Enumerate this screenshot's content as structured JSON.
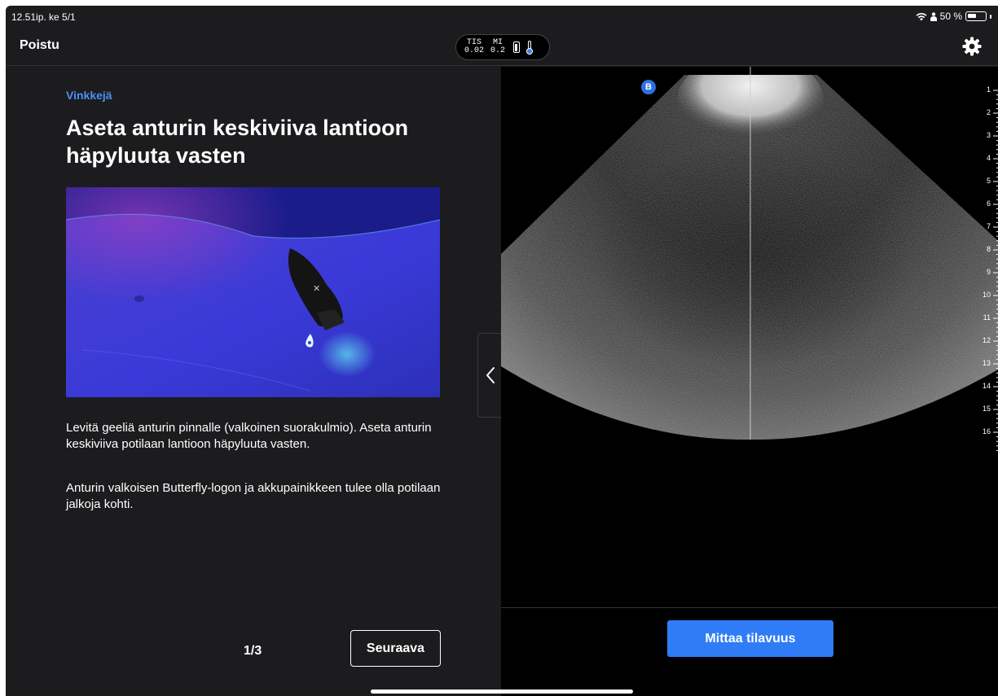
{
  "status_bar": {
    "time": "12.51ip.  ke 5/1",
    "battery_percent": "50 %"
  },
  "top_bar": {
    "exit_label": "Poistu",
    "tis_label": "TIS",
    "tis_value": "0.02",
    "mi_label": "MI",
    "mi_value": "0.2"
  },
  "tips": {
    "section_label": "Vinkkejä",
    "title": "Aseta anturin keskiviiva lantioon häpyluuta vasten",
    "paragraph_1": "Levitä geeliä anturin pinnalle (valkoinen suorakulmio). Aseta anturin keskiviiva potilaan lantioon häpyluuta vasten.",
    "paragraph_2": "Anturin valkoisen Butterfly-logon ja akkupainikkeen tulee olla potilaan jalkoja kohti.",
    "pager": "1/3",
    "next_label": "Seuraava"
  },
  "ultrasound": {
    "mode_badge": "B",
    "depth_labels": [
      "1",
      "2",
      "3",
      "4",
      "5",
      "6",
      "7",
      "8",
      "9",
      "10",
      "11",
      "12",
      "13",
      "14",
      "15",
      "16"
    ],
    "measure_label": "Mittaa tilavuus"
  },
  "colors": {
    "accent": "#2f7cf6",
    "panel": "#1c1c1e",
    "tips_label": "#4d8ff5"
  }
}
